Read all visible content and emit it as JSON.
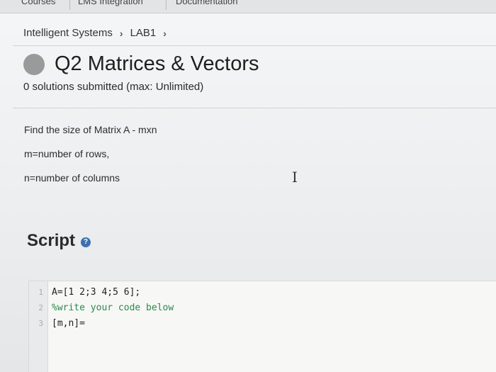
{
  "topnav": {
    "items": [
      "Courses",
      "LMS Integration",
      "Documentation"
    ]
  },
  "breadcrumb": {
    "items": [
      "Intelligent Systems",
      "LAB1"
    ]
  },
  "problem": {
    "title": "Q2 Matrices & Vectors",
    "submissions": "0 solutions submitted (max: Unlimited)",
    "description": [
      "Find the size of Matrix A  - mxn",
      "m=number of rows,",
      "n=number of columns"
    ]
  },
  "script": {
    "heading": "Script",
    "help_icon": "?",
    "lines": [
      {
        "num": "1",
        "text": "A=[1 2;3 4;5 6];",
        "kind": "code"
      },
      {
        "num": "2",
        "text": "%write your code below",
        "kind": "comment"
      },
      {
        "num": "3",
        "text": "[m,n]=",
        "kind": "code"
      }
    ]
  },
  "colors": {
    "status_dot": "#9a9a9a",
    "comment": "#2a8a4a",
    "help_icon": "#3d6fb0"
  }
}
